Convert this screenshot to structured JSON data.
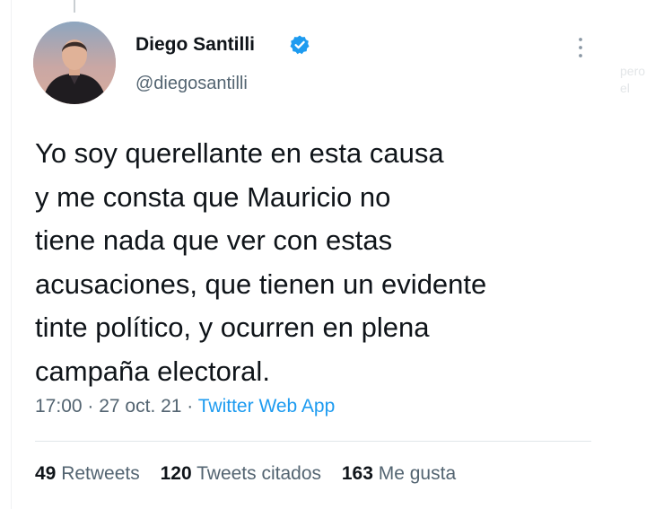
{
  "author": {
    "name": "Diego Santilli",
    "handle": "@diegosantilli",
    "verified": true
  },
  "tweet": {
    "lines": [
      "Yo soy querellante en esta causa",
      "y me consta que Mauricio no",
      "tiene nada que ver con estas",
      "acusaciones, que tienen un evidente",
      "tinte político, y ocurren en plena",
      "campaña electoral."
    ],
    "time": "17:00",
    "separator": " · ",
    "date": "27 oct. 21",
    "source": "Twitter Web App"
  },
  "stats": {
    "retweets_count": "49",
    "retweets_label": "Retweets",
    "quotes_count": "120",
    "quotes_label": "Tweets citados",
    "likes_count": "163",
    "likes_label": "Me gusta"
  },
  "background_fragment": {
    "line1": "pero",
    "line2": "el"
  },
  "icons": {
    "verified": "verified-badge-icon",
    "more": "more-options-icon"
  },
  "colors": {
    "text": "#0f1419",
    "secondary": "#536471",
    "link": "#1d9bf0",
    "verified": "#1d9bf0"
  }
}
